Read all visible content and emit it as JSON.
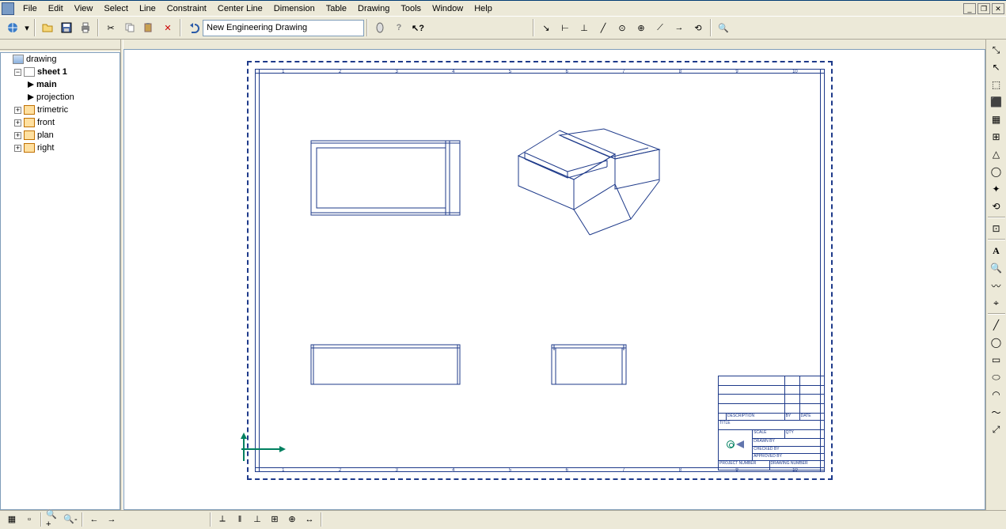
{
  "menu": [
    "File",
    "Edit",
    "View",
    "Select",
    "Line",
    "Constraint",
    "Center Line",
    "Dimension",
    "Table",
    "Drawing",
    "Tools",
    "Window",
    "Help"
  ],
  "toolbar": {
    "combo_value": "New Engineering Drawing"
  },
  "tree": {
    "root": "drawing",
    "sheet": "sheet 1",
    "main": "main",
    "projection": "projection",
    "views": [
      "trimetric",
      "front",
      "plan",
      "right"
    ]
  },
  "titleblock": {
    "row5a": "DESCRIPTION",
    "row5b": "BY",
    "row5c": "DATE",
    "row6": "TITLE",
    "row7a": "SCALE",
    "row7b": "QTY",
    "row8a": "DRAWN BY",
    "row9a": "CHECKED BY",
    "row10a": "APPROVED BY",
    "row11a": "PROJECT NUMBER",
    "row11b": "DRAWING NUMBER"
  },
  "ruler": [
    "1",
    "2",
    "3",
    "4",
    "5",
    "6",
    "7",
    "8",
    "9",
    "10"
  ],
  "vtools": [
    "⤡",
    "↖",
    "⬚",
    "⬛",
    "▦",
    "⊞",
    "△",
    "◯",
    "✦",
    "⟲",
    "⊡",
    "—",
    "A",
    "🔍",
    "〰",
    "⌖",
    "╱",
    "◯",
    "▭",
    "⬭",
    "◠",
    "〜",
    "⤢"
  ],
  "status_tools": [
    "▦",
    "▫",
    "🔍+",
    "🔍-",
    "←",
    "→"
  ],
  "status_tools2": [
    "⟂",
    "‖",
    "⊥",
    "⊞",
    "⊕",
    "↔"
  ]
}
